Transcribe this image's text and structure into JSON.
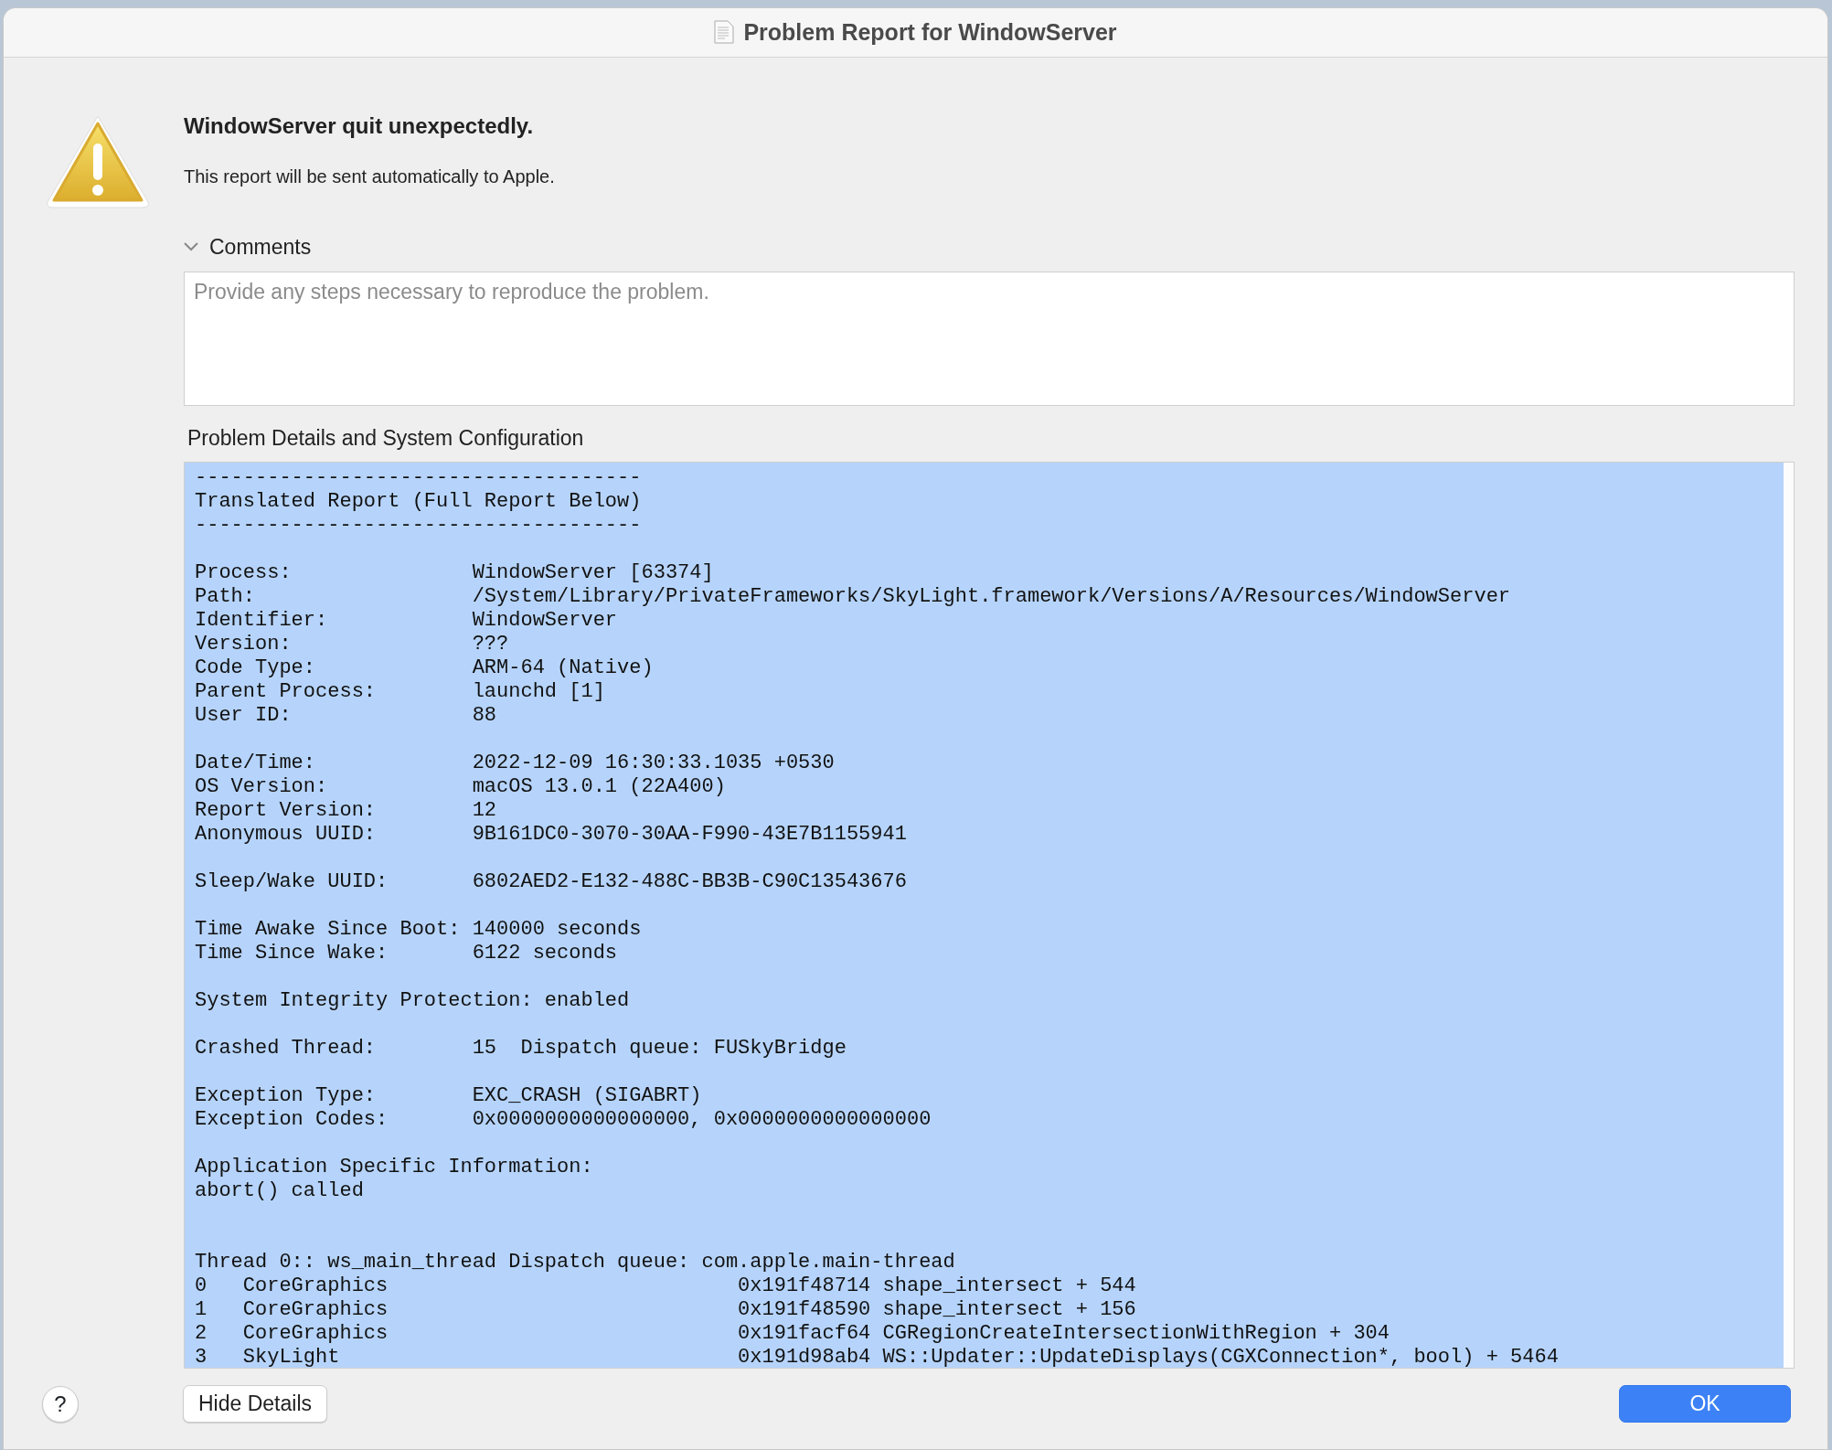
{
  "window": {
    "title": "Problem Report for WindowServer"
  },
  "heading": "WindowServer quit unexpectedly.",
  "subtitle": "This report will be sent automatically to Apple.",
  "comments": {
    "label": "Comments",
    "expanded": true,
    "placeholder": "Provide any steps necessary to reproduce the problem."
  },
  "details": {
    "label": "Problem Details and System Configuration",
    "selected": true,
    "lines": [
      {
        "kind": "text",
        "text": "-------------------------------------"
      },
      {
        "kind": "text",
        "text": "Translated Report (Full Report Below)"
      },
      {
        "kind": "text",
        "text": "-------------------------------------"
      },
      {
        "kind": "blank"
      },
      {
        "kind": "text",
        "text": "Process:               WindowServer [63374]"
      },
      {
        "kind": "text",
        "text": "Path:                  /System/Library/PrivateFrameworks/SkyLight.framework/Versions/A/Resources/WindowServer"
      },
      {
        "kind": "text",
        "text": "Identifier:            WindowServer"
      },
      {
        "kind": "text",
        "text": "Version:               ???"
      },
      {
        "kind": "text",
        "text": "Code Type:             ARM-64 (Native)"
      },
      {
        "kind": "text",
        "text": "Parent Process:        launchd [1]"
      },
      {
        "kind": "text",
        "text": "User ID:               88"
      },
      {
        "kind": "blank"
      },
      {
        "kind": "text",
        "text": "Date/Time:             2022-12-09 16:30:33.1035 +0530"
      },
      {
        "kind": "text",
        "text": "OS Version:            macOS 13.0.1 (22A400)"
      },
      {
        "kind": "text",
        "text": "Report Version:        12"
      },
      {
        "kind": "text",
        "text": "Anonymous UUID:        9B161DC0-3070-30AA-F990-43E7B1155941"
      },
      {
        "kind": "blank"
      },
      {
        "kind": "text",
        "text": "Sleep/Wake UUID:       6802AED2-E132-488C-BB3B-C90C13543676"
      },
      {
        "kind": "blank"
      },
      {
        "kind": "text",
        "text": "Time Awake Since Boot: 140000 seconds"
      },
      {
        "kind": "text",
        "text": "Time Since Wake:       6122 seconds"
      },
      {
        "kind": "blank"
      },
      {
        "kind": "text",
        "text": "System Integrity Protection: enabled"
      },
      {
        "kind": "blank"
      },
      {
        "kind": "text",
        "text": "Crashed Thread:        15  Dispatch queue: FUSkyBridge"
      },
      {
        "kind": "blank"
      },
      {
        "kind": "text",
        "text": "Exception Type:        EXC_CRASH (SIGABRT)"
      },
      {
        "kind": "text",
        "text": "Exception Codes:       0x0000000000000000, 0x0000000000000000"
      },
      {
        "kind": "blank"
      },
      {
        "kind": "text",
        "text": "Application Specific Information:"
      },
      {
        "kind": "text",
        "text": "abort() called"
      },
      {
        "kind": "blank"
      },
      {
        "kind": "blank"
      },
      {
        "kind": "text",
        "text": "Thread 0:: ws_main_thread Dispatch queue: com.apple.main-thread"
      },
      {
        "kind": "text",
        "text": "0   CoreGraphics                             0x191f48714 shape_intersect + 544"
      },
      {
        "kind": "text",
        "text": "1   CoreGraphics                             0x191f48590 shape_intersect + 156"
      },
      {
        "kind": "text",
        "text": "2   CoreGraphics                             0x191facf64 CGRegionCreateIntersectionWithRegion + 304"
      },
      {
        "kind": "text",
        "text": "3   SkyLight                                 0x191d98ab4 WS::Updater::UpdateDisplays(CGXConnection*, bool) + 5464"
      }
    ]
  },
  "help_button": "?",
  "buttons": [
    {
      "label": "Hide Details",
      "kind": "secondary"
    },
    {
      "label": "OK",
      "kind": "primary"
    }
  ]
}
